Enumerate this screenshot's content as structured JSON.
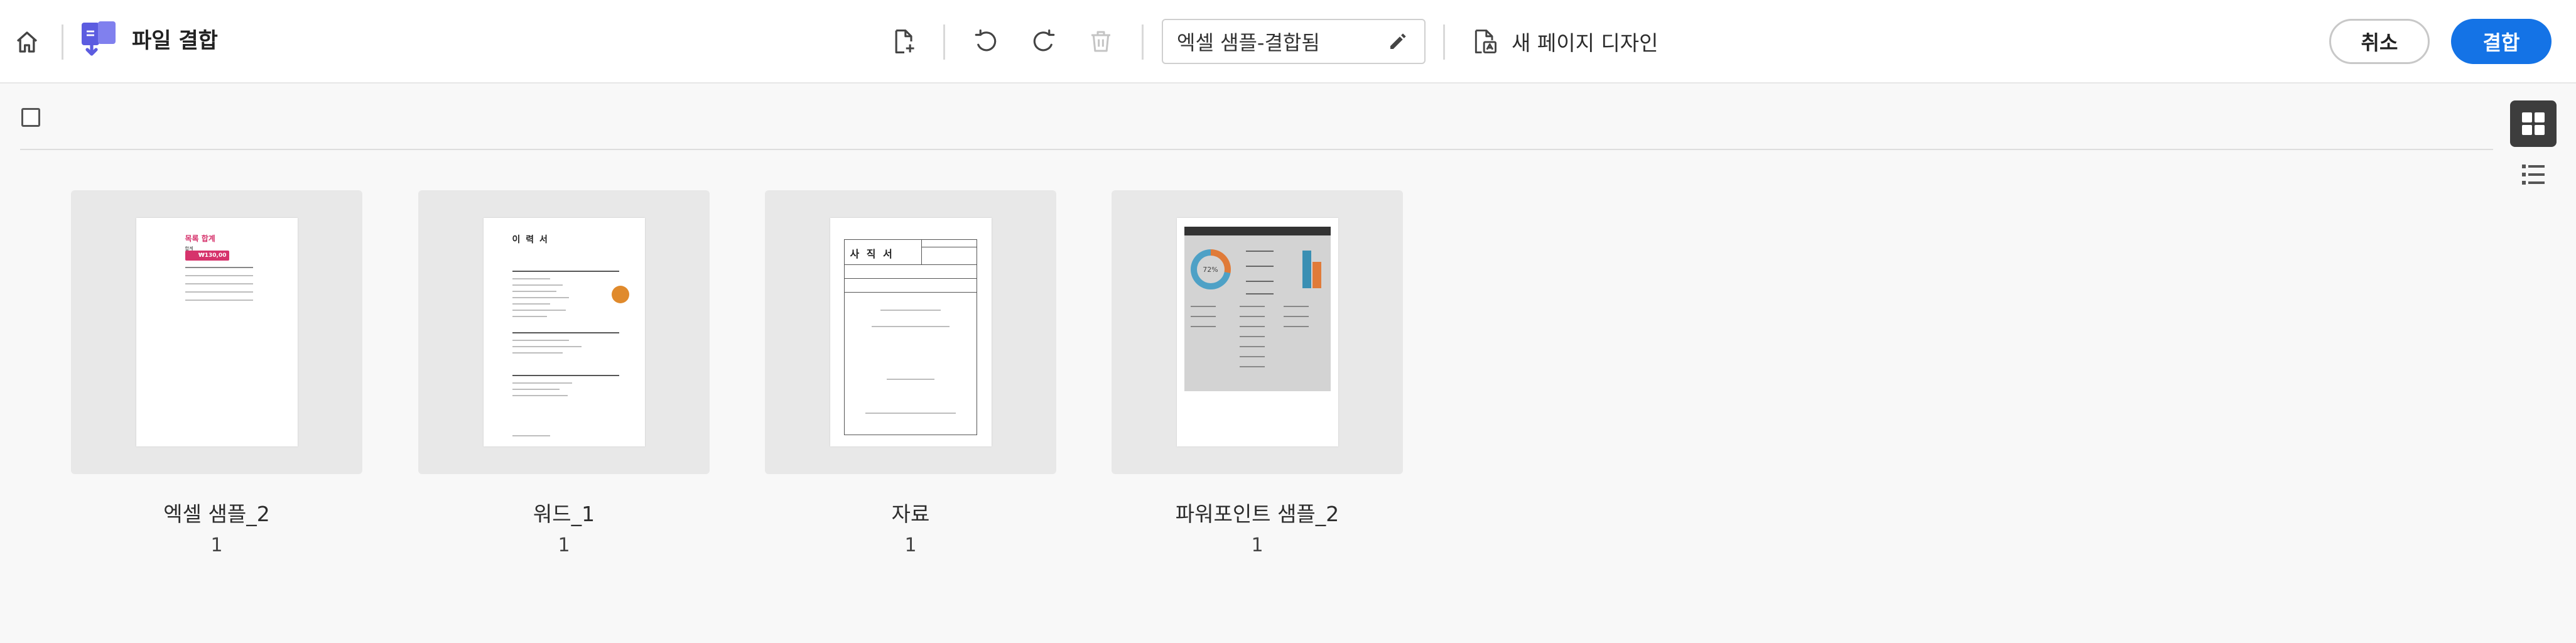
{
  "toolbar": {
    "app_title": "파일 결합",
    "file_name": "엑셀 샘플-결합됨",
    "new_page_design_label": "새 페이지 디자인",
    "cancel_label": "취소",
    "combine_label": "결합"
  },
  "colors": {
    "primary": "#1473e6",
    "app_icon": "#5c5ce0"
  },
  "files": [
    {
      "name": "엑셀 샘플_2",
      "pages": "1",
      "preview": {
        "heading": "목록 합계",
        "badge": "₩130,00"
      }
    },
    {
      "name": "워드_1",
      "pages": "1",
      "preview": {
        "heading": "이 력 서"
      }
    },
    {
      "name": "자료",
      "pages": "1",
      "preview": {
        "heading": "사 직 서"
      }
    },
    {
      "name": "파워포인트 샘플_2",
      "pages": "1",
      "preview": {
        "donut_value": "72%"
      }
    }
  ]
}
